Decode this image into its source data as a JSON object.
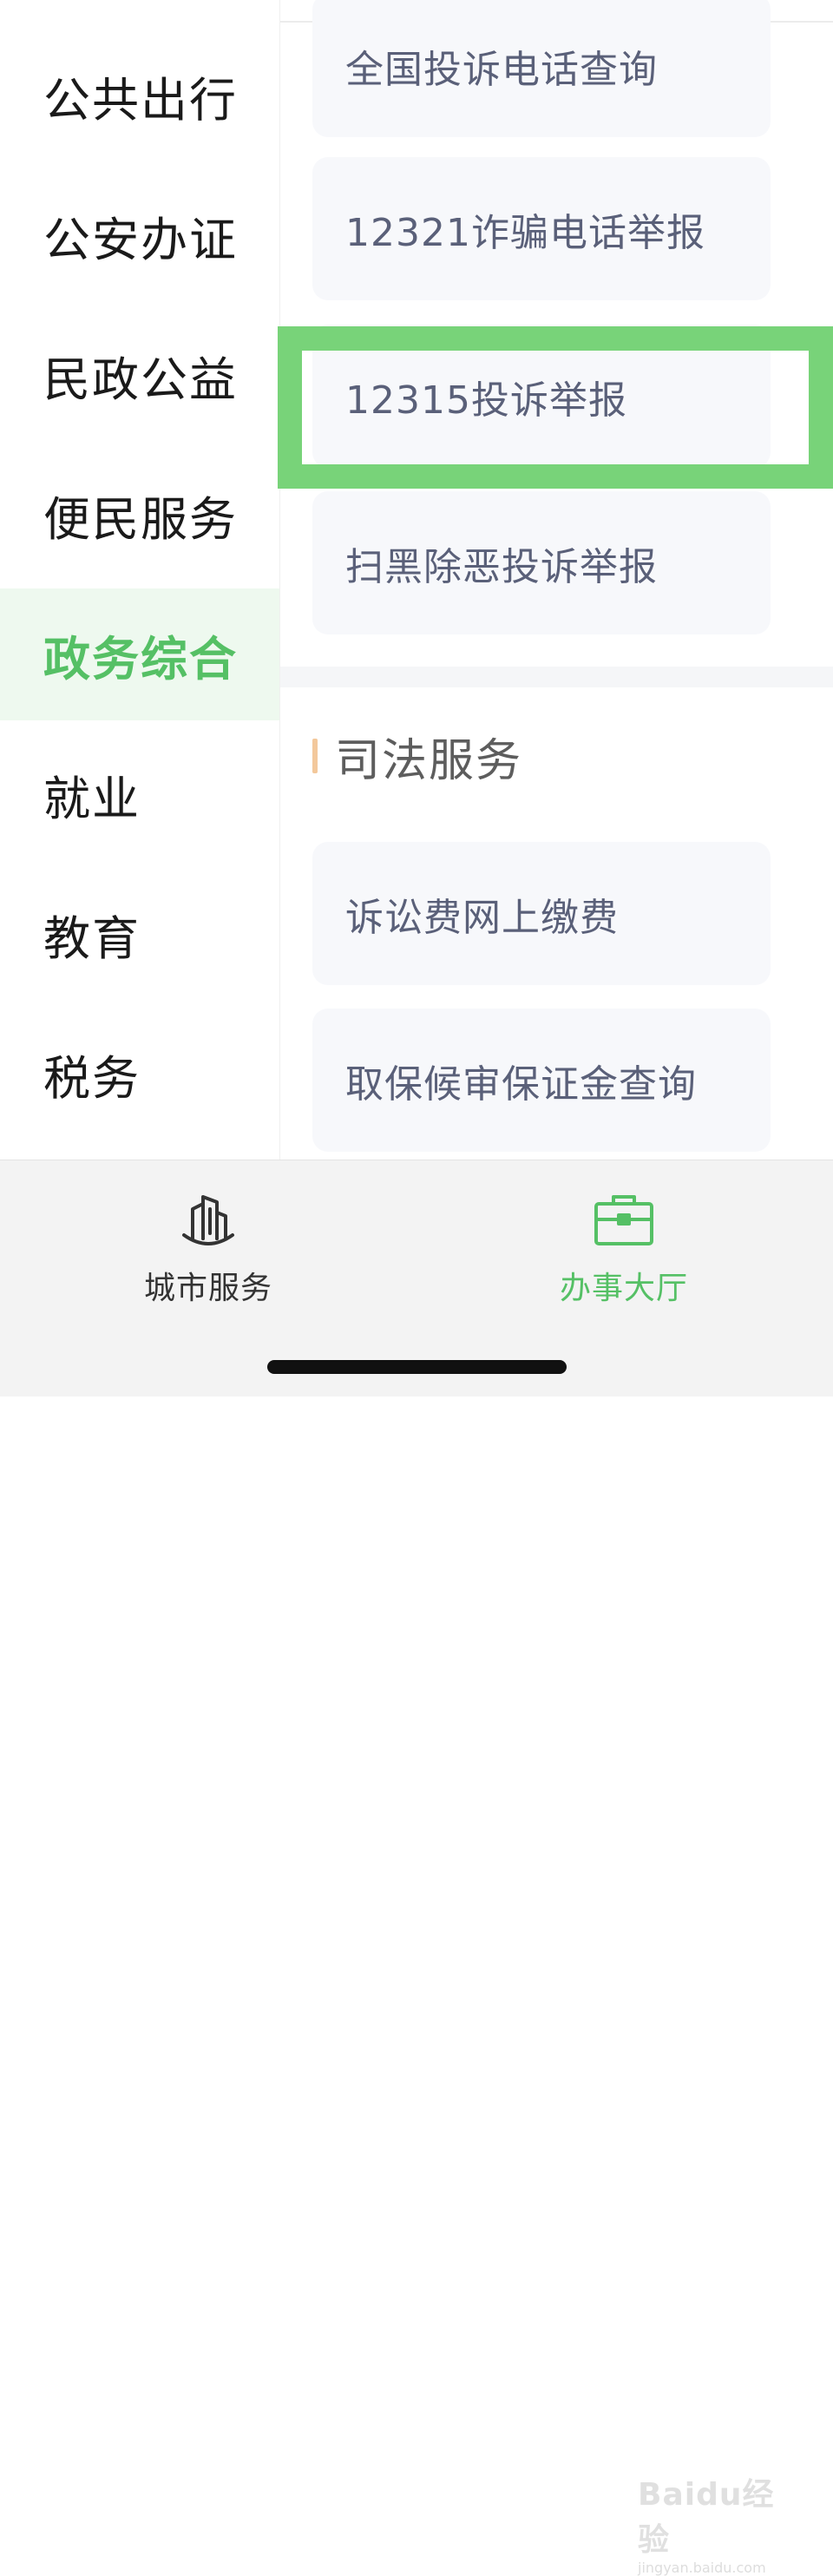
{
  "sidebar": {
    "items": [
      {
        "label": "公共出行",
        "active": false
      },
      {
        "label": "公安办证",
        "active": false
      },
      {
        "label": "民政公益",
        "active": false
      },
      {
        "label": "便民服务",
        "active": false
      },
      {
        "label": "政务综合",
        "active": true
      },
      {
        "label": "就业",
        "active": false
      },
      {
        "label": "教育",
        "active": false
      },
      {
        "label": "税务",
        "active": false
      }
    ]
  },
  "content": {
    "group1": {
      "items": [
        {
          "label": "全国投诉电话查询"
        },
        {
          "label": "12321诈骗电话举报"
        },
        {
          "label": "12315投诉举报",
          "highlighted": true
        },
        {
          "label": "扫黑除恶投诉举报"
        }
      ]
    },
    "group2": {
      "title": "司法服务",
      "items": [
        {
          "label": "诉讼费网上缴费"
        },
        {
          "label": "取保候审保证金查询"
        }
      ]
    }
  },
  "tabbar": {
    "tabs": [
      {
        "label": "城市服务",
        "icon": "city-building-icon",
        "active": false
      },
      {
        "label": "办事大厅",
        "icon": "briefcase-icon",
        "active": true
      }
    ]
  },
  "watermark": {
    "logo": "Baidu经验",
    "sub": "jingyan.baidu.com"
  },
  "colors": {
    "accent": "#55c065",
    "highlight": "#78d379",
    "section_bar": "#f3c89b"
  }
}
